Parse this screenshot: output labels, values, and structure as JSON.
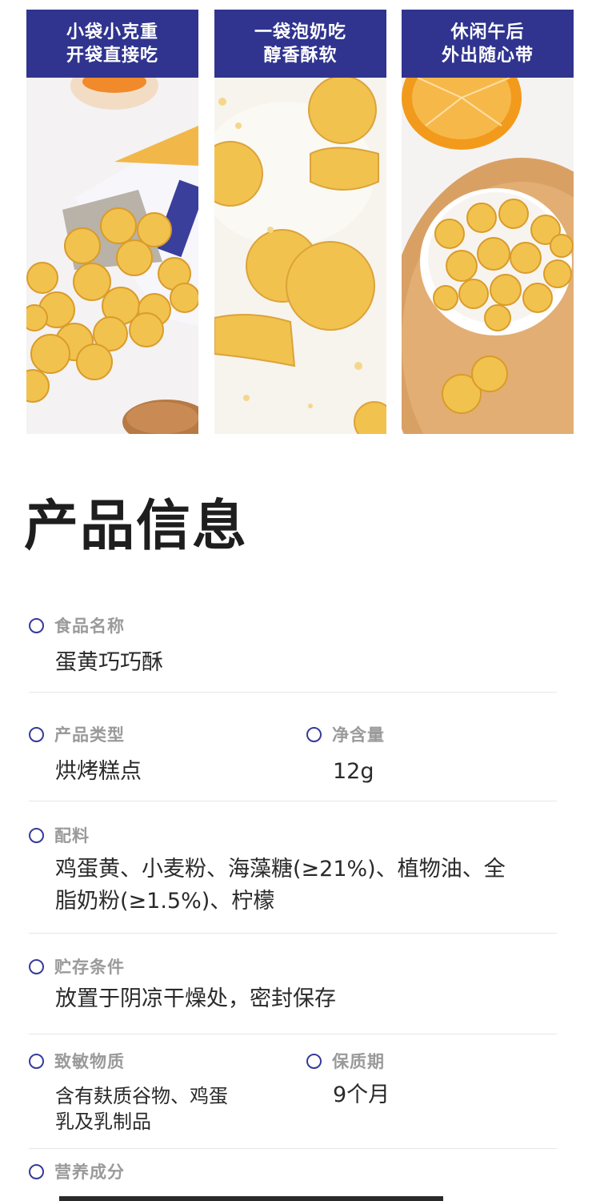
{
  "panels": [
    {
      "line1": "小袋小克重",
      "line2": "开袋直接吃"
    },
    {
      "line1": "一袋泡奶吃",
      "line2": "醇香酥软"
    },
    {
      "line1": "休闲午后",
      "line2": "外出随心带"
    }
  ],
  "section_title": "产品信息",
  "fields": {
    "food_name": {
      "label": "食品名称",
      "value": "蛋黄巧巧酥"
    },
    "product_type": {
      "label": "产品类型",
      "value": "烘烤糕点"
    },
    "net_content": {
      "label": "净含量",
      "value": "12g"
    },
    "ingredients": {
      "label": "配料",
      "value_line1": "鸡蛋黄、小麦粉、海藻糖(≥21%)、植物油、全",
      "value_line2": "脂奶粉(≥1.5%)、柠檬"
    },
    "storage": {
      "label": "贮存条件",
      "value": "放置于阴凉干燥处，密封保存"
    },
    "allergens": {
      "label": "致敏物质",
      "value_line1": "含有麸质谷物、鸡蛋",
      "value_line2": "乳及乳制品"
    },
    "shelf_life": {
      "label": "保质期",
      "value": "9个月"
    },
    "nutrition": {
      "label": "营养成分"
    }
  },
  "colors": {
    "banner": "#30348f",
    "bullet": "#353a9a",
    "label": "#9a9a9a",
    "biscuit": "#f2c24e"
  }
}
